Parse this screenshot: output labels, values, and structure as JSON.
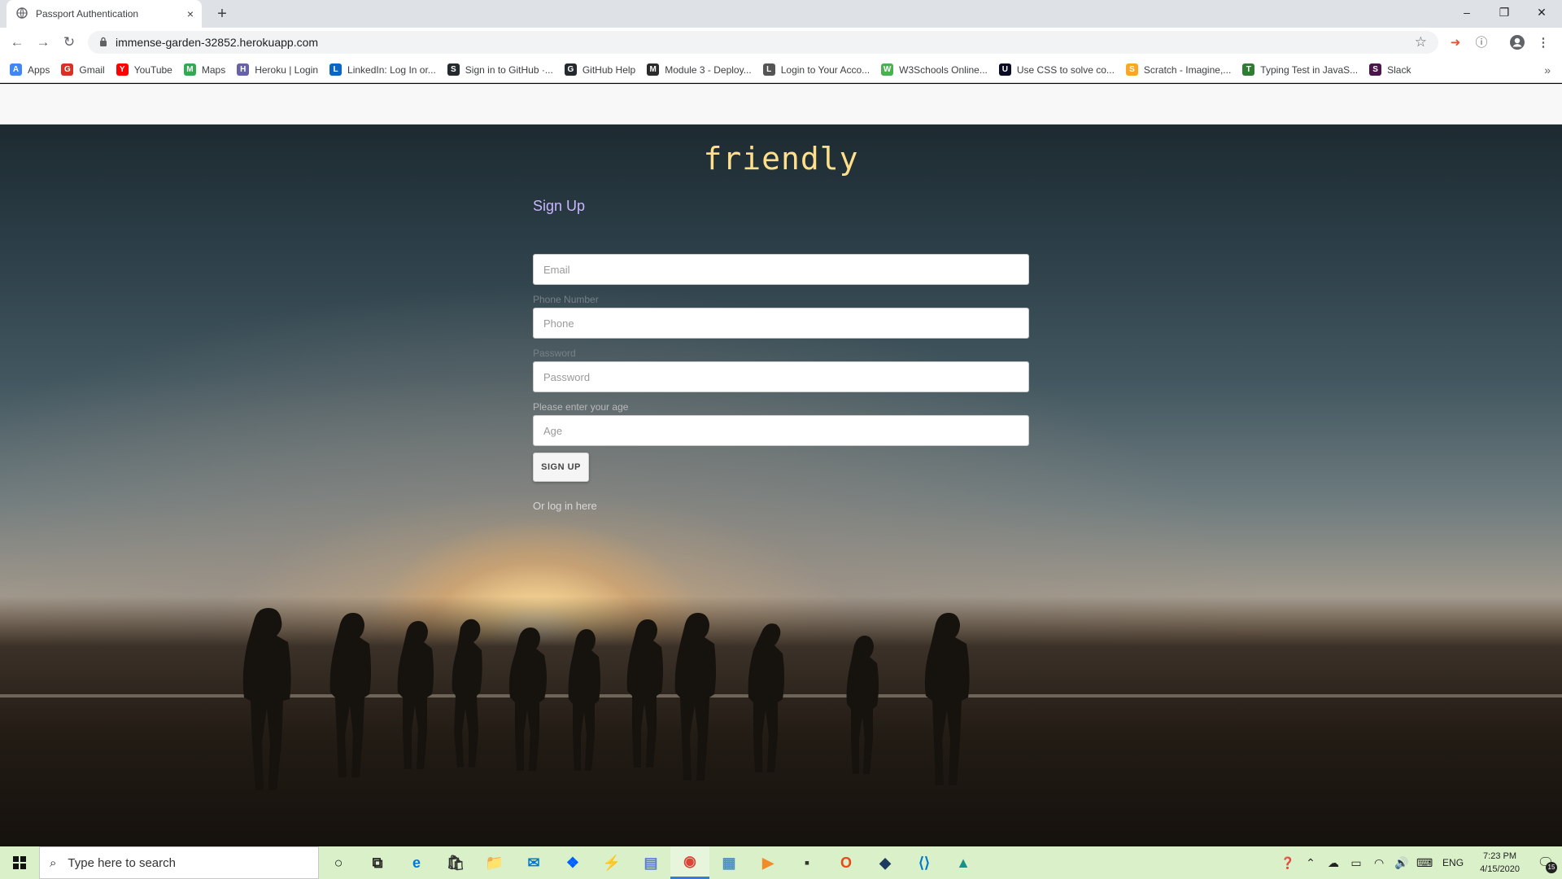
{
  "browser": {
    "tab_title": "Passport Authentication",
    "tab_close": "×",
    "new_tab": "+",
    "url": "immense-garden-32852.herokuapp.com",
    "window": {
      "minimize": "–",
      "restore": "❐",
      "close": "✕"
    },
    "nav": {
      "back": "←",
      "forward": "→",
      "reload": "↻"
    },
    "star": "☆",
    "bookmarks": [
      {
        "label": "Apps",
        "icon": "apps-grid-icon",
        "color": "#4285f4"
      },
      {
        "label": "Gmail",
        "icon": "gmail-icon",
        "color": "#d93025"
      },
      {
        "label": "YouTube",
        "icon": "youtube-icon",
        "color": "#ff0000"
      },
      {
        "label": "Maps",
        "icon": "maps-icon",
        "color": "#34a853"
      },
      {
        "label": "Heroku | Login",
        "icon": "heroku-icon",
        "color": "#6762a6"
      },
      {
        "label": "LinkedIn: Log In or...",
        "icon": "linkedin-icon",
        "color": "#0a66c2"
      },
      {
        "label": "Sign in to GitHub ·...",
        "icon": "github-icon",
        "color": "#24292e"
      },
      {
        "label": "GitHub Help",
        "icon": "github-icon",
        "color": "#24292e"
      },
      {
        "label": "Module 3 - Deploy...",
        "icon": "book-icon",
        "color": "#2b2b2b"
      },
      {
        "label": "Login to Your Acco...",
        "icon": "globe-icon",
        "color": "#555555"
      },
      {
        "label": "W3Schools Online...",
        "icon": "w3schools-icon",
        "color": "#4caf50"
      },
      {
        "label": "Use CSS to solve co...",
        "icon": "freecodecamp-icon",
        "color": "#0a0a23"
      },
      {
        "label": "Scratch - Imagine,...",
        "icon": "scratch-icon",
        "color": "#f9a825"
      },
      {
        "label": "Typing Test in JavaS...",
        "icon": "t-icon",
        "color": "#2e7d32"
      },
      {
        "label": "Slack",
        "icon": "slack-icon",
        "color": "#4a154b"
      }
    ],
    "bookmarks_more": "»"
  },
  "page": {
    "brand": "friendly",
    "form": {
      "heading": "Sign Up",
      "email_placeholder": "Email",
      "phone_label": "Phone Number",
      "phone_placeholder": "Phone",
      "password_label": "Password",
      "password_placeholder": "Password",
      "age_label": "Please enter your age",
      "age_placeholder": "Age",
      "submit_label": "SIGN UP",
      "login_link": "Or log in here"
    }
  },
  "taskbar": {
    "search_placeholder": "Type here to search",
    "apps": [
      {
        "name": "cortana-icon",
        "glyph": "○",
        "color": "#222222"
      },
      {
        "name": "task-view-icon",
        "glyph": "⧉",
        "color": "#222222"
      },
      {
        "name": "edge-icon",
        "glyph": "e",
        "color": "#0078d7"
      },
      {
        "name": "store-icon",
        "glyph": "🛍",
        "color": "#333333"
      },
      {
        "name": "file-explorer-icon",
        "glyph": "📁",
        "color": "#f2c94c"
      },
      {
        "name": "mail-icon",
        "glyph": "✉",
        "color": "#0078d7"
      },
      {
        "name": "dropbox-icon",
        "glyph": "❖",
        "color": "#0061fe"
      },
      {
        "name": "app-green-icon",
        "glyph": "⚡",
        "color": "#6abf4b"
      },
      {
        "name": "app-blue-icon",
        "glyph": "▤",
        "color": "#5b7bd5"
      },
      {
        "name": "chrome-icon",
        "glyph": "◉",
        "color": "#db4437"
      },
      {
        "name": "notepad-icon",
        "glyph": "▦",
        "color": "#4a90c2"
      },
      {
        "name": "media-player-icon",
        "glyph": "▶",
        "color": "#f28c28"
      },
      {
        "name": "sticky-notes-icon",
        "glyph": "▪",
        "color": "#333333"
      },
      {
        "name": "office-icon",
        "glyph": "O",
        "color": "#e64a19"
      },
      {
        "name": "mysql-workbench-icon",
        "glyph": "◆",
        "color": "#1e3a5f"
      },
      {
        "name": "vscode-icon",
        "glyph": "⟨⟩",
        "color": "#007acc"
      },
      {
        "name": "git-kraken-icon",
        "glyph": "▲",
        "color": "#179287"
      }
    ],
    "tray": {
      "language": "ENG",
      "time": "7:23 PM",
      "date": "4/15/2020",
      "notifications": "15"
    }
  }
}
